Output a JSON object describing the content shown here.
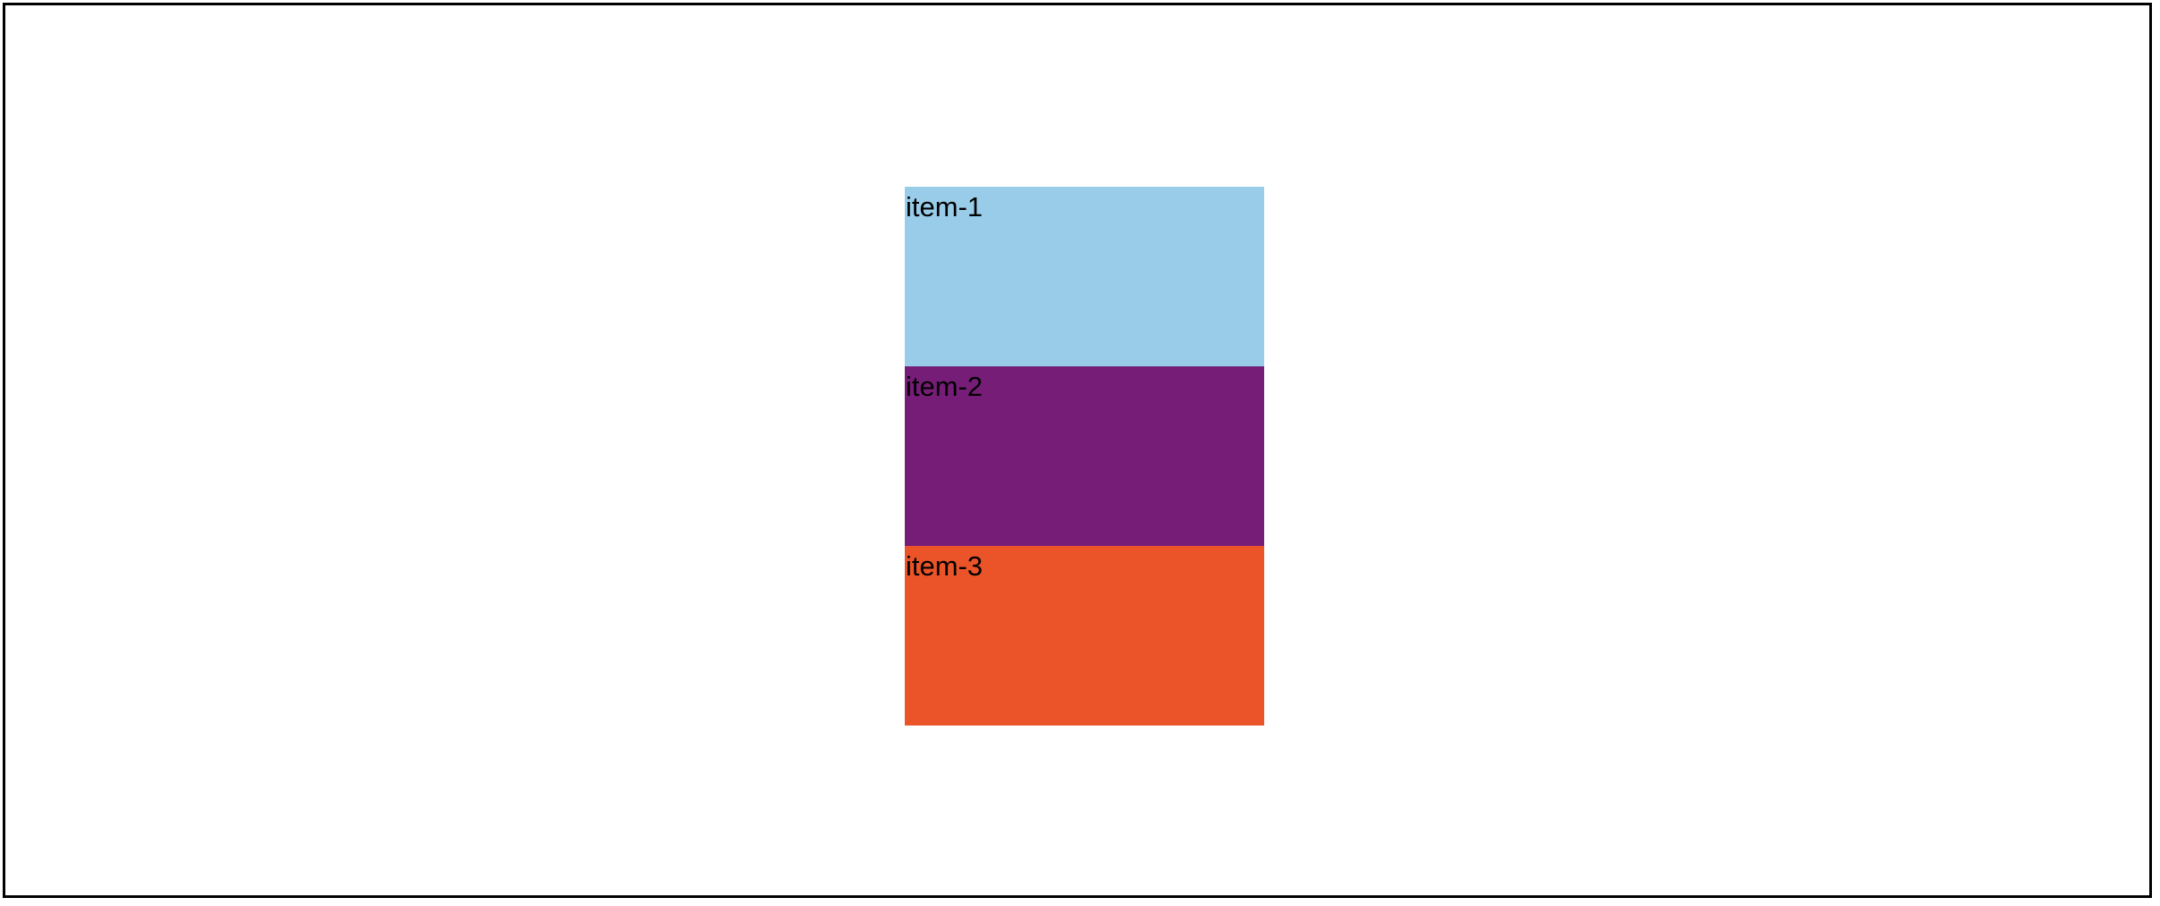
{
  "items": [
    {
      "label": "item-1",
      "color": "#98CCE8"
    },
    {
      "label": "item-2",
      "color": "#761D78"
    },
    {
      "label": "item-3",
      "color": "#EB5428"
    }
  ],
  "frame": {
    "border_color": "#000000",
    "background": "#ffffff"
  }
}
